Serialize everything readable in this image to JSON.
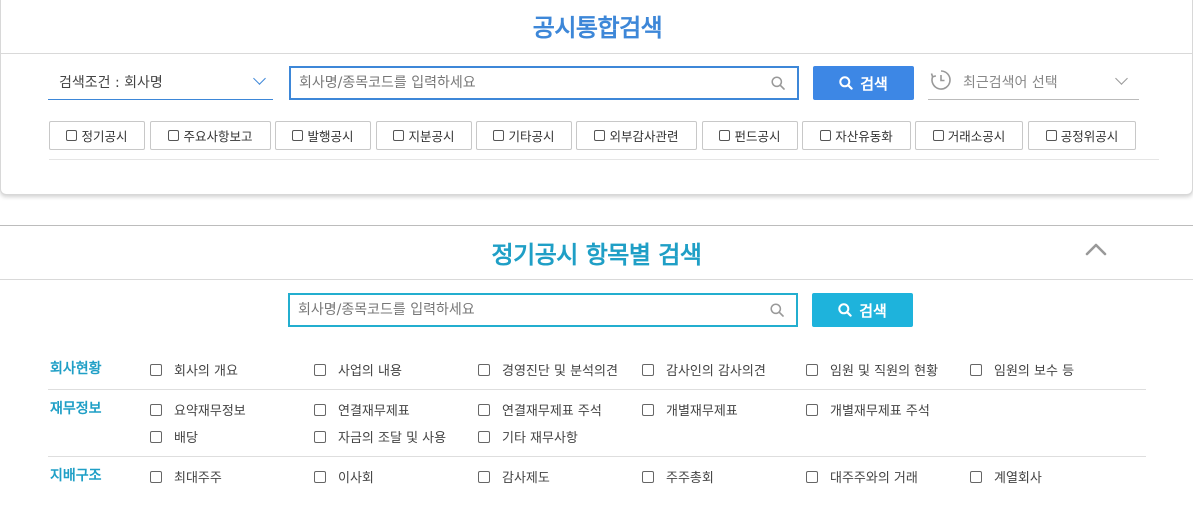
{
  "unified": {
    "title": "공시통합검색",
    "condition_label": "검색조건 : 회사명",
    "search_placeholder": "회사명/종목코드를 입력하세요",
    "search_button": "검색",
    "recent_label": "최근검색어 선택",
    "disclosure_types": [
      "정기공시",
      "주요사항보고",
      "발행공시",
      "지분공시",
      "기타공시",
      "외부감사관련",
      "펀드공시",
      "자산유동화",
      "거래소공시",
      "공정위공시"
    ]
  },
  "periodic": {
    "title": "정기공시 항목별 검색",
    "search_placeholder": "회사명/종목코드를 입력하세요",
    "search_button": "검색",
    "categories": [
      {
        "label": "회사현황",
        "items": [
          "회사의 개요",
          "사업의 내용",
          "경영진단 및 분석의견",
          "감사인의 감사의견",
          "임원 및 직원의 현황",
          "임원의 보수 등"
        ]
      },
      {
        "label": "재무정보",
        "items": [
          "요약재무정보",
          "연결재무제표",
          "연결재무제표 주석",
          "개별재무제표",
          "개별재무제표 주석",
          "배당",
          "자금의 조달 및 사용",
          "기타 재무사항"
        ]
      },
      {
        "label": "지배구조",
        "items": [
          "최대주주",
          "이사회",
          "감사제도",
          "주주총회",
          "대주주와의 거래",
          "계열회사"
        ]
      }
    ]
  },
  "colors": {
    "primary_blue": "#3d87e5",
    "teal": "#1eb3dc"
  }
}
